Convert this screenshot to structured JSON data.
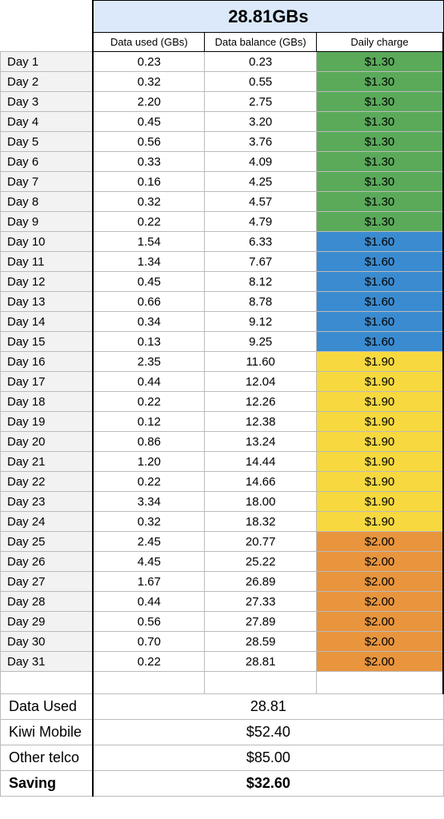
{
  "heading": "28.81GBs",
  "columns": {
    "used": "Data used (GBs)",
    "balance": "Data balance (GBs)",
    "charge": "Daily charge"
  },
  "rows": [
    {
      "day": "Day 1",
      "used": "0.23",
      "balance": "0.23",
      "charge": "$1.30",
      "tier": "green"
    },
    {
      "day": "Day 2",
      "used": "0.32",
      "balance": "0.55",
      "charge": "$1.30",
      "tier": "green"
    },
    {
      "day": "Day 3",
      "used": "2.20",
      "balance": "2.75",
      "charge": "$1.30",
      "tier": "green"
    },
    {
      "day": "Day 4",
      "used": "0.45",
      "balance": "3.20",
      "charge": "$1.30",
      "tier": "green"
    },
    {
      "day": "Day 5",
      "used": "0.56",
      "balance": "3.76",
      "charge": "$1.30",
      "tier": "green"
    },
    {
      "day": "Day 6",
      "used": "0.33",
      "balance": "4.09",
      "charge": "$1.30",
      "tier": "green"
    },
    {
      "day": "Day 7",
      "used": "0.16",
      "balance": "4.25",
      "charge": "$1.30",
      "tier": "green"
    },
    {
      "day": "Day 8",
      "used": "0.32",
      "balance": "4.57",
      "charge": "$1.30",
      "tier": "green"
    },
    {
      "day": "Day 9",
      "used": "0.22",
      "balance": "4.79",
      "charge": "$1.30",
      "tier": "green"
    },
    {
      "day": "Day 10",
      "used": "1.54",
      "balance": "6.33",
      "charge": "$1.60",
      "tier": "blue"
    },
    {
      "day": "Day 11",
      "used": "1.34",
      "balance": "7.67",
      "charge": "$1.60",
      "tier": "blue"
    },
    {
      "day": "Day 12",
      "used": "0.45",
      "balance": "8.12",
      "charge": "$1.60",
      "tier": "blue"
    },
    {
      "day": "Day 13",
      "used": "0.66",
      "balance": "8.78",
      "charge": "$1.60",
      "tier": "blue"
    },
    {
      "day": "Day 14",
      "used": "0.34",
      "balance": "9.12",
      "charge": "$1.60",
      "tier": "blue"
    },
    {
      "day": "Day 15",
      "used": "0.13",
      "balance": "9.25",
      "charge": "$1.60",
      "tier": "blue"
    },
    {
      "day": "Day 16",
      "used": "2.35",
      "balance": "11.60",
      "charge": "$1.90",
      "tier": "yellow"
    },
    {
      "day": "Day 17",
      "used": "0.44",
      "balance": "12.04",
      "charge": "$1.90",
      "tier": "yellow"
    },
    {
      "day": "Day 18",
      "used": "0.22",
      "balance": "12.26",
      "charge": "$1.90",
      "tier": "yellow"
    },
    {
      "day": "Day 19",
      "used": "0.12",
      "balance": "12.38",
      "charge": "$1.90",
      "tier": "yellow"
    },
    {
      "day": "Day 20",
      "used": "0.86",
      "balance": "13.24",
      "charge": "$1.90",
      "tier": "yellow"
    },
    {
      "day": "Day 21",
      "used": "1.20",
      "balance": "14.44",
      "charge": "$1.90",
      "tier": "yellow"
    },
    {
      "day": "Day 22",
      "used": "0.22",
      "balance": "14.66",
      "charge": "$1.90",
      "tier": "yellow"
    },
    {
      "day": "Day 23",
      "used": "3.34",
      "balance": "18.00",
      "charge": "$1.90",
      "tier": "yellow"
    },
    {
      "day": "Day 24",
      "used": "0.32",
      "balance": "18.32",
      "charge": "$1.90",
      "tier": "yellow"
    },
    {
      "day": "Day 25",
      "used": "2.45",
      "balance": "20.77",
      "charge": "$2.00",
      "tier": "orange"
    },
    {
      "day": "Day 26",
      "used": "4.45",
      "balance": "25.22",
      "charge": "$2.00",
      "tier": "orange"
    },
    {
      "day": "Day 27",
      "used": "1.67",
      "balance": "26.89",
      "charge": "$2.00",
      "tier": "orange"
    },
    {
      "day": "Day 28",
      "used": "0.44",
      "balance": "27.33",
      "charge": "$2.00",
      "tier": "orange"
    },
    {
      "day": "Day 29",
      "used": "0.56",
      "balance": "27.89",
      "charge": "$2.00",
      "tier": "orange"
    },
    {
      "day": "Day 30",
      "used": "0.70",
      "balance": "28.59",
      "charge": "$2.00",
      "tier": "orange"
    },
    {
      "day": "Day 31",
      "used": "0.22",
      "balance": "28.81",
      "charge": "$2.00",
      "tier": "orange"
    }
  ],
  "summary": [
    {
      "label": "Data Used",
      "value": "28.81",
      "bold": false
    },
    {
      "label": "Kiwi Mobile",
      "value": "$52.40",
      "bold": false
    },
    {
      "label": "Other telco",
      "value": "$85.00",
      "bold": false
    },
    {
      "label": "Saving",
      "value": "$32.60",
      "bold": true
    }
  ]
}
